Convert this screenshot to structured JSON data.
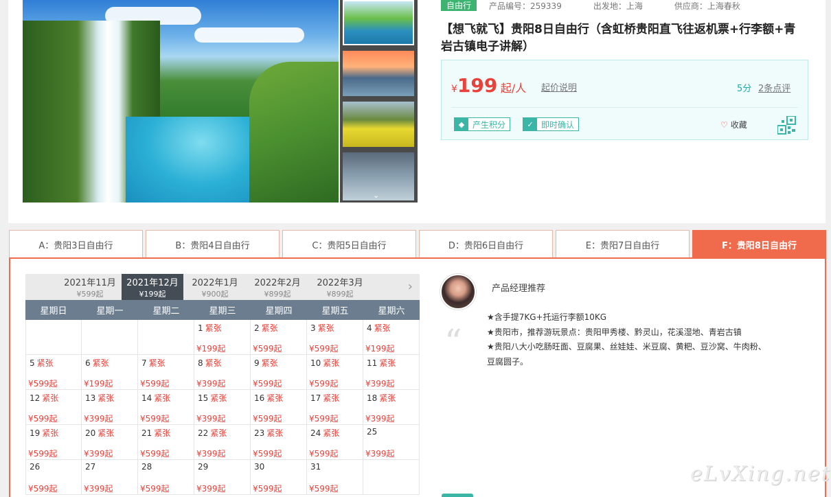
{
  "product": {
    "tag": "自由行",
    "code": "产品编号：259339",
    "departure": "出发地：上海",
    "supplier": "供应商：上海春秋",
    "title": "【想飞就飞】贵阳8日自由行（含虹桥贵阳直飞往返机票+行李额+青岩古镇电子讲解）",
    "price_symbol": "¥",
    "price": "199",
    "price_unit": "起/人",
    "price_note": "起价说明",
    "score": "5分",
    "reviews": "2条点评",
    "badge_points": "产生积分",
    "badge_confirm": "即时确认",
    "favorite": "收藏",
    "accent": "#f06b4c",
    "teal": "#3bb6a6"
  },
  "tabs": [
    {
      "label": "A：贵阳3日自由行",
      "active": false
    },
    {
      "label": "B：贵阳4日自由行",
      "active": false
    },
    {
      "label": "C：贵阳5日自由行",
      "active": false
    },
    {
      "label": "D：贵阳6日自由行",
      "active": false
    },
    {
      "label": "E：贵阳7日自由行",
      "active": false
    },
    {
      "label": "F：贵阳8日自由行",
      "active": true
    }
  ],
  "months": [
    {
      "label": "2021年11月",
      "price": "¥599起",
      "active": false
    },
    {
      "label": "2021年12月",
      "price": "¥199起",
      "active": true
    },
    {
      "label": "2022年1月",
      "price": "¥900起",
      "active": false
    },
    {
      "label": "2022年2月",
      "price": "¥899起",
      "active": false
    },
    {
      "label": "2022年3月",
      "price": "¥899起",
      "active": false
    }
  ],
  "weekdays": [
    "星期日",
    "星期一",
    "星期二",
    "星期三",
    "星期四",
    "星期五",
    "星期六"
  ],
  "calendar": [
    [
      null,
      null,
      null,
      {
        "day": "1",
        "status": "紧张",
        "price": "¥199起"
      },
      {
        "day": "2",
        "status": "紧张",
        "price": "¥599起"
      },
      {
        "day": "3",
        "status": "紧张",
        "price": "¥599起"
      },
      {
        "day": "4",
        "status": "紧张",
        "price": "¥199起"
      }
    ],
    [
      {
        "day": "5",
        "status": "紧张",
        "price": "¥599起"
      },
      {
        "day": "6",
        "status": "紧张",
        "price": "¥199起"
      },
      {
        "day": "7",
        "status": "紧张",
        "price": "¥599起"
      },
      {
        "day": "8",
        "status": "紧张",
        "price": "¥399起"
      },
      {
        "day": "9",
        "status": "紧张",
        "price": "¥599起"
      },
      {
        "day": "10",
        "status": "紧张",
        "price": "¥599起"
      },
      {
        "day": "11",
        "status": "紧张",
        "price": "¥399起"
      }
    ],
    [
      {
        "day": "12",
        "status": "紧张",
        "price": "¥599起"
      },
      {
        "day": "13",
        "status": "紧张",
        "price": "¥399起"
      },
      {
        "day": "14",
        "status": "紧张",
        "price": "¥599起"
      },
      {
        "day": "15",
        "status": "紧张",
        "price": "¥399起"
      },
      {
        "day": "16",
        "status": "紧张",
        "price": "¥599起"
      },
      {
        "day": "17",
        "status": "紧张",
        "price": "¥599起"
      },
      {
        "day": "18",
        "status": "紧张",
        "price": "¥399起"
      }
    ],
    [
      {
        "day": "19",
        "status": "紧张",
        "price": "¥599起"
      },
      {
        "day": "20",
        "status": "紧张",
        "price": "¥399起"
      },
      {
        "day": "21",
        "status": "紧张",
        "price": "¥599起"
      },
      {
        "day": "22",
        "status": "紧张",
        "price": "¥399起"
      },
      {
        "day": "23",
        "status": "紧张",
        "price": "¥599起"
      },
      {
        "day": "24",
        "status": "紧张",
        "price": "¥599起"
      },
      {
        "day": "25",
        "status": "",
        "price": "¥399起"
      }
    ],
    [
      {
        "day": "26",
        "status": "",
        "price": "¥599起"
      },
      {
        "day": "27",
        "status": "",
        "price": "¥399起"
      },
      {
        "day": "28",
        "status": "",
        "price": "¥599起"
      },
      {
        "day": "29",
        "status": "",
        "price": "¥399起"
      },
      {
        "day": "30",
        "status": "",
        "price": "¥599起"
      },
      {
        "day": "31",
        "status": "",
        "price": "¥599起"
      },
      null
    ]
  ],
  "recommend": {
    "title": "产品经理推荐",
    "lines": [
      "★含手提7KG+托运行李额10KG",
      "★贵阳市，推荐游玩景点：贵阳甲秀楼、黔灵山，花溪湿地、青岩古镇",
      "★贵阳八大小吃肠旺面、豆腐果、丝娃娃、米豆腐、黄粑、豆沙窝、牛肉粉、",
      "豆腐圆子。"
    ]
  },
  "watermark": "eLvXing.net"
}
